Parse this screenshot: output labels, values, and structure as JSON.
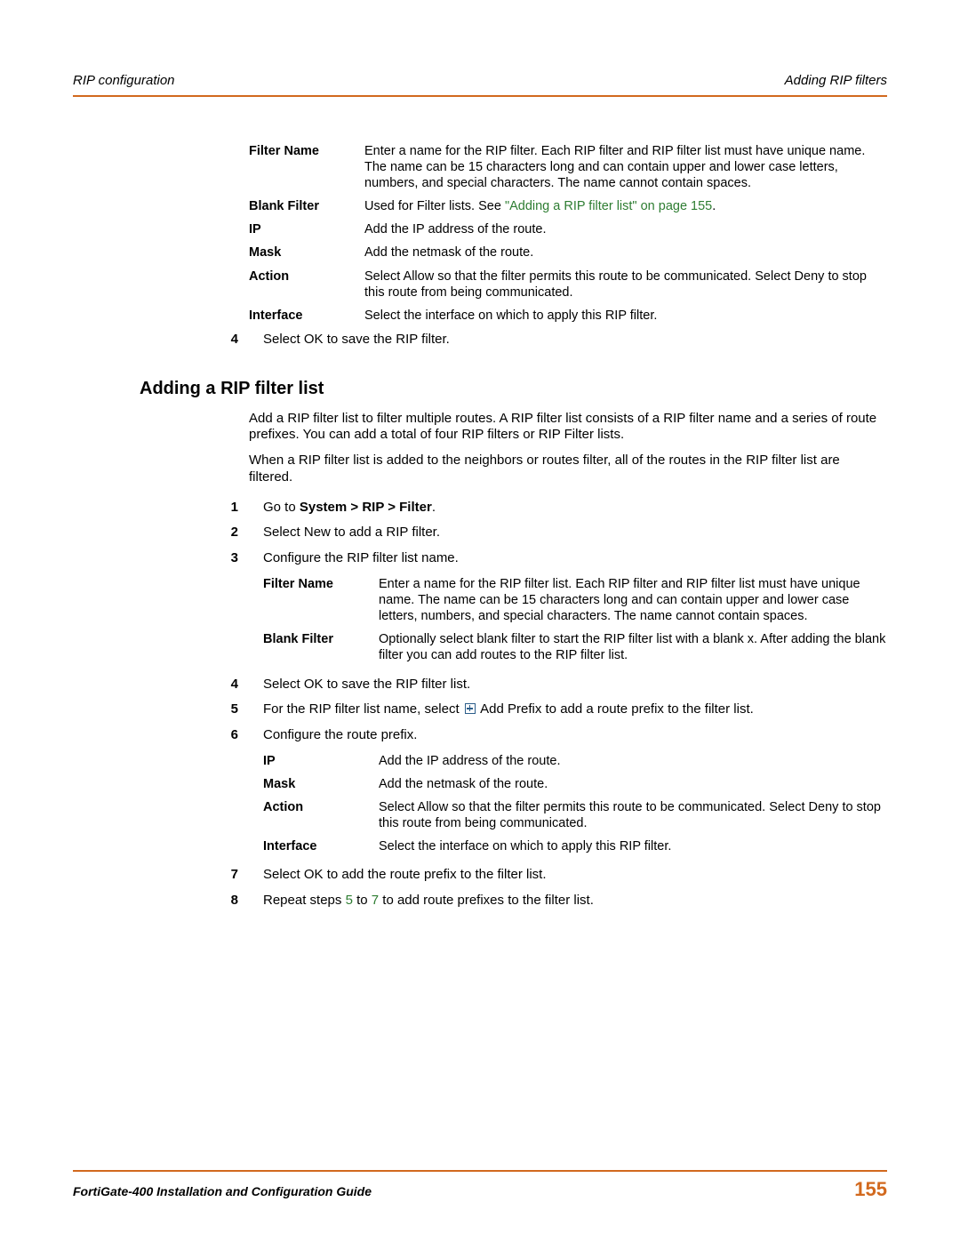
{
  "header": {
    "left": "RIP configuration",
    "right": "Adding RIP filters"
  },
  "def1": {
    "filter_name": {
      "term": "Filter Name",
      "desc": "Enter a name for the RIP filter. Each RIP filter and RIP filter list must have unique name. The name can be 15 characters long and can contain upper and lower case letters, numbers, and special characters. The name cannot contain spaces."
    },
    "blank_filter": {
      "term": "Blank Filter",
      "desc_pre": "Used for Filter lists. See ",
      "link": "\"Adding a RIP filter list\" on page 155",
      "desc_post": "."
    },
    "ip": {
      "term": "IP",
      "desc": "Add the IP address of the route."
    },
    "mask": {
      "term": "Mask",
      "desc": "Add the netmask of the route."
    },
    "action": {
      "term": "Action",
      "desc": "Select Allow so that the filter permits this route to be communicated. Select Deny to stop this route from being communicated."
    },
    "interface": {
      "term": "Interface",
      "desc": "Select the interface on which to apply this RIP filter."
    }
  },
  "step4a": {
    "num": "4",
    "text": "Select OK to save the RIP filter."
  },
  "heading": "Adding a RIP filter list",
  "intro1": "Add a RIP filter list to filter multiple routes. A RIP filter list consists of a RIP filter name and a series of route prefixes. You can add a total of four RIP filters or RIP Filter lists.",
  "intro2": "When a RIP filter list is added to the neighbors or routes filter, all of the routes in the RIP filter list are filtered.",
  "steps": {
    "s1": {
      "num": "1",
      "pre": "Go to ",
      "bold": "System > RIP > Filter",
      "post": "."
    },
    "s2": {
      "num": "2",
      "text": "Select New to add a RIP filter."
    },
    "s3": {
      "num": "3",
      "text": "Configure the RIP filter list name."
    },
    "s4": {
      "num": "4",
      "text": "Select OK to save the RIP filter list."
    },
    "s5": {
      "num": "5",
      "pre": "For the RIP filter list name, select ",
      "post": " Add Prefix to add a route prefix to the filter list."
    },
    "s6": {
      "num": "6",
      "text": "Configure the route prefix."
    },
    "s7": {
      "num": "7",
      "text": "Select OK to add the route prefix to the filter list."
    },
    "s8": {
      "num": "8",
      "pre": "Repeat steps ",
      "link1": "5",
      "mid": " to ",
      "link2": "7",
      "post": " to add route prefixes to the filter list."
    }
  },
  "def2": {
    "filter_name": {
      "term": "Filter Name",
      "desc": "Enter a name for the RIP filter list. Each RIP filter and RIP filter list must have unique name. The name can be 15 characters long and can contain upper and lower case letters, numbers, and special characters. The name cannot contain spaces."
    },
    "blank_filter": {
      "term": "Blank Filter",
      "desc": "Optionally select blank filter to start the RIP filter list with a blank x. After adding the blank filter you can add routes to the RIP filter list."
    }
  },
  "def3": {
    "ip": {
      "term": "IP",
      "desc": "Add the IP address of the route."
    },
    "mask": {
      "term": "Mask",
      "desc": "Add the netmask of the route."
    },
    "action": {
      "term": "Action",
      "desc": "Select Allow so that the filter permits this route to be communicated. Select Deny to stop this route from being communicated."
    },
    "interface": {
      "term": "Interface",
      "desc": "Select the interface on which to apply this RIP filter."
    }
  },
  "footer": {
    "title": "FortiGate-400 Installation and Configuration Guide",
    "page": "155"
  }
}
